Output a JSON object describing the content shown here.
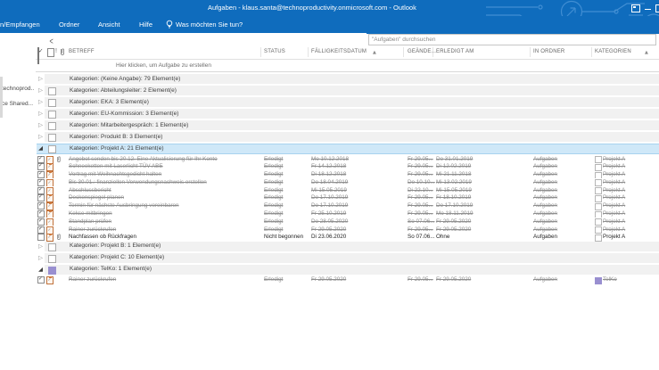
{
  "title_bar": {
    "title": "Aufgaben - klaus.santa@technoproductivity.onmicrosoft.com - Outlook"
  },
  "ribbon": {
    "tabs": [
      "n/Empfangen",
      "Ordner",
      "Ansicht",
      "Hilfe"
    ],
    "tell_me": "Was möchten Sie tun?"
  },
  "search": {
    "placeholder": "\"Aufgaben\" durchsuchen"
  },
  "folder_pane": {
    "items": [
      "technoprod..",
      "ce Shared..."
    ]
  },
  "list": {
    "headers": {
      "betreff": "BETREFF",
      "status": "STATUS",
      "due": "FÄLLIGKEITSDATUM",
      "changed": "GEÄNDE...",
      "completed": "ERLEDIGT AM",
      "folder": "IN ORDNER",
      "categories": "KATEGORIEN"
    },
    "new_task_hint": "Hier klicken, um Aufgabe zu erstellen",
    "groups": [
      {
        "label": "Kategorien: (Keine Angabe): 79 Element(e)",
        "state": "collapsed",
        "selected": false,
        "swatch": "none",
        "tasks": []
      },
      {
        "label": "Kategorien: Abteilungsleiter: 2 Element(e)",
        "state": "collapsed",
        "selected": false,
        "swatch": "empty",
        "tasks": []
      },
      {
        "label": "Kategorien: EKA: 3 Element(e)",
        "state": "collapsed",
        "selected": false,
        "swatch": "empty",
        "tasks": []
      },
      {
        "label": "Kategorien: EU-Kommission: 3 Element(e)",
        "state": "collapsed",
        "selected": false,
        "swatch": "empty",
        "tasks": []
      },
      {
        "label": "Kategorien: Mitarbeitergespräch: 1 Element(e)",
        "state": "collapsed",
        "selected": false,
        "swatch": "empty",
        "tasks": []
      },
      {
        "label": "Kategorien: Produkt B: 3 Element(e)",
        "state": "collapsed",
        "selected": false,
        "swatch": "empty",
        "tasks": []
      },
      {
        "label": "Kategorien: Projekt A: 21 Element(e)",
        "state": "expanded",
        "selected": true,
        "swatch": "empty",
        "tasks": [
          {
            "subject": "Angebot senden bis 20.12. Eine Aktualisierung für Ihr Konto",
            "attachment": true,
            "status": "Erledigt",
            "due": "Mo 10.12.2018",
            "changed": "Fr 29.05...",
            "completed": "Do 31.01.2019",
            "folder": "Aufgaben",
            "category": "Projekt A",
            "category_color": "#ffffff",
            "done": true
          },
          {
            "subject": "Schneeketten mit Laserlicht TÜV ABE",
            "attachment": false,
            "status": "Erledigt",
            "due": "Fr 14.12.2018",
            "changed": "Fr 29.05...",
            "completed": "Di 12.02.2019",
            "folder": "Aufgaben",
            "category": "Projekt A",
            "category_color": "#ffffff",
            "done": true
          },
          {
            "subject": "Vortrag mit Weihnachtsgedicht halten",
            "attachment": false,
            "status": "Erledigt",
            "due": "Di 18.12.2018",
            "changed": "Fr 29.05...",
            "completed": "Mi 21.11.2018",
            "folder": "Aufgaben",
            "category": "Projekt A",
            "category_color": "#ffffff",
            "done": true
          },
          {
            "subject": "Bis 30.01.: finanziellen Verwendungsnachweis erstellen",
            "attachment": false,
            "status": "Erledigt",
            "due": "Do 18.04.2019",
            "changed": "Do 10.10...",
            "completed": "Mi 13.02.2019",
            "folder": "Aufgaben",
            "category": "Projekt A",
            "category_color": "#ffffff",
            "done": true
          },
          {
            "subject": "Abschlussbericht",
            "attachment": false,
            "status": "Erledigt",
            "due": "Mi 15.05.2019",
            "changed": "Di 22.10...",
            "completed": "Mi 15.05.2019",
            "folder": "Aufgaben",
            "category": "Projekt A",
            "category_color": "#ffffff",
            "done": true
          },
          {
            "subject": "Deckenspiegel planen",
            "attachment": false,
            "status": "Erledigt",
            "due": "Do 17.10.2019",
            "changed": "Fr 29.05...",
            "completed": "Fr 18.10.2019",
            "folder": "Aufgaben",
            "category": "Projekt A",
            "category_color": "#ffffff",
            "done": true
          },
          {
            "subject": "Termin für nächste Ausbringung vereinbaren",
            "attachment": false,
            "status": "Erledigt",
            "due": "Do 17.10.2019",
            "changed": "Fr 29.05...",
            "completed": "Do 17.10.2019",
            "folder": "Aufgaben",
            "category": "Projekt A",
            "category_color": "#ffffff",
            "done": true
          },
          {
            "subject": "Kekse mitbringen",
            "attachment": false,
            "status": "Erledigt",
            "due": "Fr 25.10.2019",
            "changed": "Fr 29.05...",
            "completed": "Mo 18.11.2019",
            "folder": "Aufgaben",
            "category": "Projekt A",
            "category_color": "#ffffff",
            "done": true
          },
          {
            "subject": "Standplan prüfen",
            "attachment": false,
            "status": "Erledigt",
            "due": "Do 28.05.2020",
            "changed": "So 07.06...",
            "completed": "Fr 29.05.2020",
            "folder": "Aufgaben",
            "category": "Projekt A",
            "category_color": "#ffffff",
            "done": true
          },
          {
            "subject": "Rainer zurückrufen",
            "attachment": false,
            "status": "Erledigt",
            "due": "Fr 29.05.2020",
            "changed": "Fr 29.05...",
            "completed": "Fr 29.05.2020",
            "folder": "Aufgaben",
            "category": "Projekt A",
            "category_color": "#ffffff",
            "done": true
          },
          {
            "subject": "Nachfassen ob Rückfragen",
            "attachment": true,
            "status": "Nicht begonnen",
            "due": "Di 23.06.2020",
            "changed": "So 07.06...",
            "completed": "Ohne",
            "folder": "Aufgaben",
            "category": "Projekt A",
            "category_color": "#ffffff",
            "done": false
          }
        ]
      },
      {
        "label": "Kategorien: Projekt B: 1 Element(e)",
        "state": "collapsed",
        "selected": false,
        "swatch": "empty",
        "tasks": []
      },
      {
        "label": "Kategorien: Projekt C: 10 Element(e)",
        "state": "collapsed",
        "selected": false,
        "swatch": "empty",
        "tasks": []
      },
      {
        "label": "Kategorien: TelKo: 1 Element(e)",
        "state": "expanded",
        "selected": false,
        "swatch": "#998fd0",
        "tasks": [
          {
            "subject": "Rainer zurückrufen",
            "attachment": false,
            "status": "Erledigt",
            "due": "Fr 29.05.2020",
            "changed": "Fr 29.05...",
            "completed": "Fr 29.05.2020",
            "folder": "Aufgaben",
            "category": "TelKo",
            "category_color": "#998fd0",
            "done": true
          }
        ]
      }
    ]
  },
  "colors": {
    "accent_blue": "#0f6cbd",
    "selection_blue": "#cfe8f8",
    "telko_purple": "#998fd0",
    "task_icon_orange": "#c0713a"
  }
}
